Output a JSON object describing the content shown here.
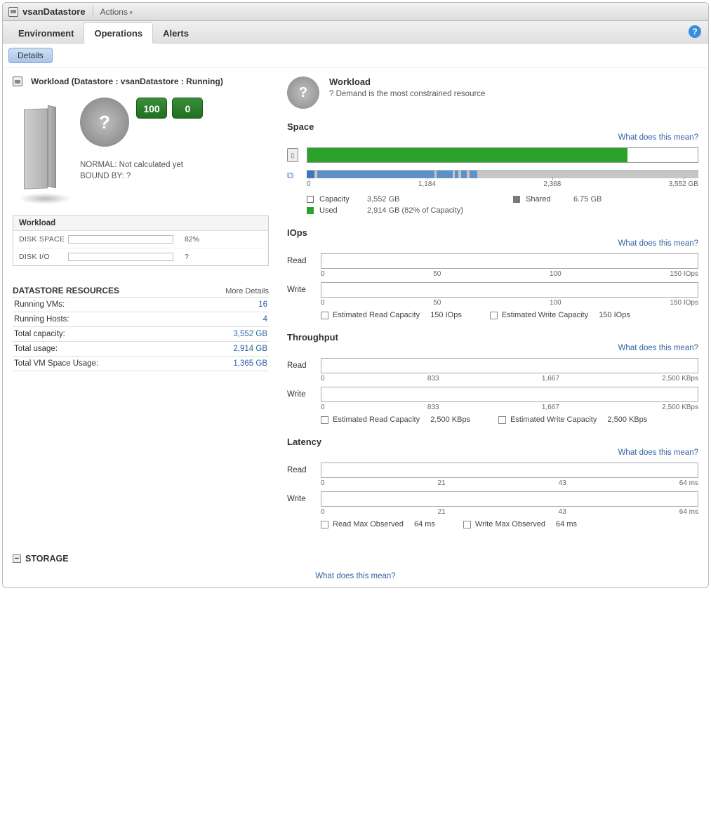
{
  "titlebar": {
    "title": "vsanDatastore",
    "actions": "Actions"
  },
  "tabs": {
    "environment": "Environment",
    "operations": "Operations",
    "alerts": "Alerts"
  },
  "details_btn": "Details",
  "left": {
    "heading": "Workload (Datastore : vsanDatastore : Running)",
    "badge1": "100",
    "badge2": "0",
    "status1": "NORMAL: Not calculated yet",
    "status2": "BOUND BY: ?",
    "workload_title": "Workload",
    "rows": [
      {
        "label": "DISK SPACE",
        "pct": 82,
        "val": "82%"
      },
      {
        "label": "DISK I/O",
        "pct": 0,
        "val": "?"
      }
    ],
    "resources_title": "DATASTORE RESOURCES",
    "more_details": "More Details",
    "resources": [
      {
        "label": "Running VMs:",
        "val": "16"
      },
      {
        "label": "Running Hosts:",
        "val": "4"
      },
      {
        "label": "Total capacity:",
        "val": "3,552 GB"
      },
      {
        "label": "Total usage:",
        "val": "2,914 GB"
      },
      {
        "label": "Total VM Space Usage:",
        "val": "1,365 GB"
      }
    ]
  },
  "right": {
    "header_title": "Workload",
    "header_sub": "? Demand is the most constrained resource",
    "help_text": "What does this mean?",
    "space": {
      "title": "Space",
      "fill_pct": 82,
      "axis": [
        "0",
        "1,184",
        "2,368",
        "3,552 GB"
      ],
      "legend": {
        "capacity_label": "Capacity",
        "capacity_val": "3,552 GB",
        "shared_label": "Shared",
        "shared_val": "6.75 GB",
        "used_label": "Used",
        "used_val": "2,914 GB (82% of Capacity)"
      }
    },
    "iops": {
      "title": "IOps",
      "read": "Read",
      "write": "Write",
      "axis": [
        "0",
        "50",
        "100",
        "150 IOps"
      ],
      "est_read_label": "Estimated Read Capacity",
      "est_read_val": "150 IOps",
      "est_write_label": "Estimated Write Capacity",
      "est_write_val": "150 IOps"
    },
    "throughput": {
      "title": "Throughput",
      "read": "Read",
      "write": "Write",
      "axis": [
        "0",
        "833",
        "1,667",
        "2,500 KBps"
      ],
      "est_read_label": "Estimated Read Capacity",
      "est_read_val": "2,500 KBps",
      "est_write_label": "Estimated Write Capacity",
      "est_write_val": "2,500 KBps"
    },
    "latency": {
      "title": "Latency",
      "read": "Read",
      "write": "Write",
      "axis": [
        "0",
        "21",
        "43",
        "64 ms"
      ],
      "est_read_label": "Read Max Observed",
      "est_read_val": "64 ms",
      "est_write_label": "Write Max Observed",
      "est_write_val": "64 ms"
    }
  },
  "storage": {
    "title": "STORAGE",
    "help": "What does this mean?"
  }
}
